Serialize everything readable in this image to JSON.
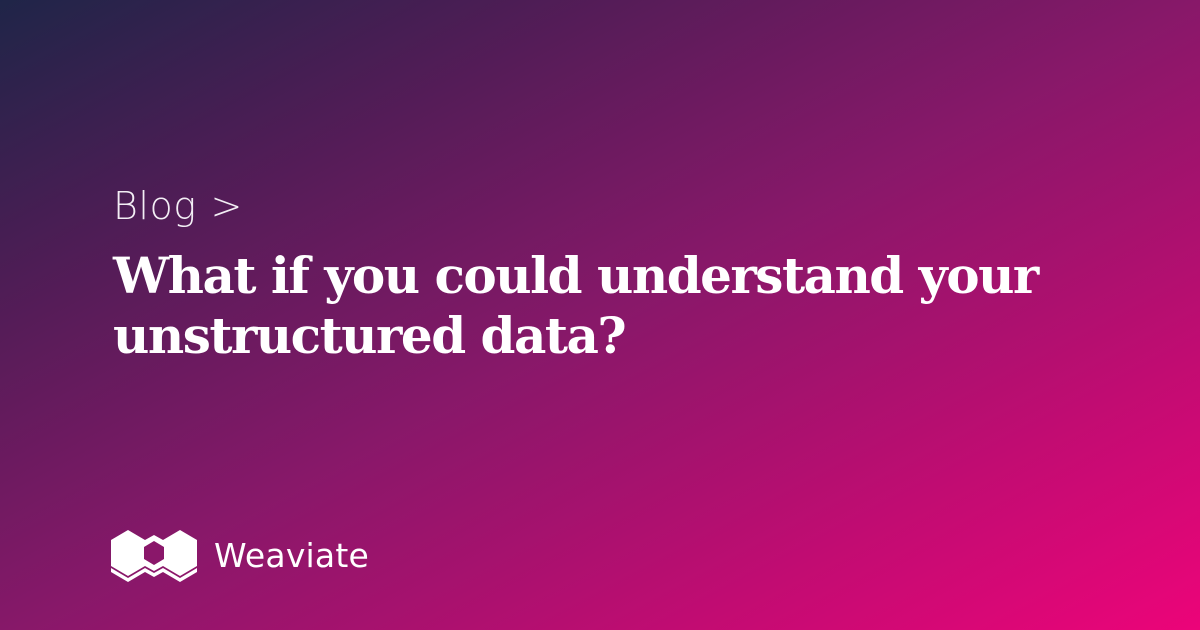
{
  "breadcrumb": {
    "section": "Blog",
    "separator": ">"
  },
  "title": "What if you could understand your unstructured data?",
  "logo": {
    "icon": "weaviate-logo-icon",
    "name": "Weaviate"
  },
  "colors": {
    "gradient_start": "#1f2548",
    "gradient_mid": "#871869",
    "gradient_end": "#ec0479",
    "text": "#ffffff"
  }
}
